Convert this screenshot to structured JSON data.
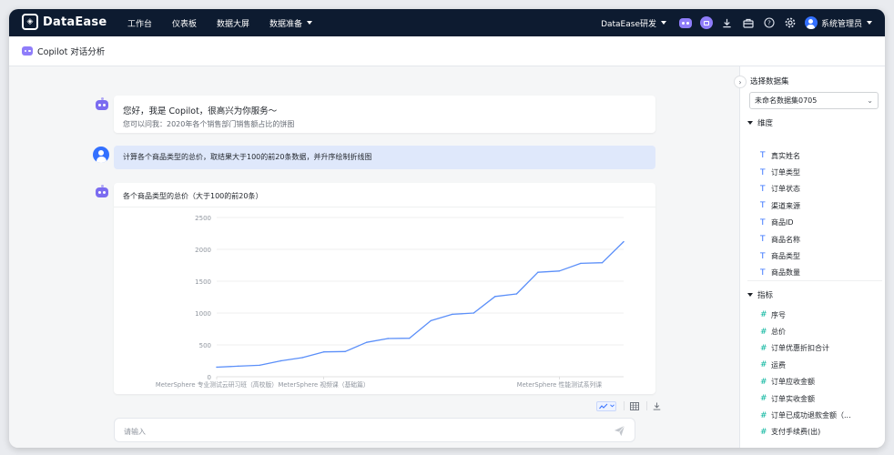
{
  "app": {
    "logo_text": "DataEase",
    "nav": [
      {
        "label": "工作台",
        "has_caret": false
      },
      {
        "label": "仪表板",
        "has_caret": false
      },
      {
        "label": "数据大屏",
        "has_caret": false
      },
      {
        "label": "数据准备",
        "has_caret": true
      }
    ],
    "workspace": "DataEase研发",
    "user": "系统管理员",
    "icons": [
      "copilot-icon",
      "ai-chat-icon",
      "download-icon",
      "toolbox-icon",
      "help-icon",
      "settings-icon"
    ]
  },
  "page": {
    "title": "Copilot 对话分析"
  },
  "chat": {
    "greeting": {
      "title": "您好，我是 Copilot，很高兴为你服务～",
      "subtitle": "您可以问我：2020年各个销售部门销售额占比的饼图"
    },
    "user_message": "计算各个商品类型的总价，取结果大于100的前20条数据，并升序绘制折线图",
    "answer": {
      "chart_title": "各个商品类型的总价（大于100的前20条）"
    },
    "input_placeholder": "请输入"
  },
  "chart_data": {
    "type": "line",
    "title": "各个商品类型的总价（大于100的前20条）",
    "ylim": [
      0,
      2500
    ],
    "yticks": [
      "0",
      "500",
      "1000",
      "1500",
      "2000",
      "2500"
    ],
    "x_tick_labels": [
      {
        "index": 0,
        "label": "MeterSphere 专业测试云研习班（高校版）"
      },
      {
        "index": 5,
        "label": "MeterSphere 视频课（基础篇）"
      },
      {
        "index": 16,
        "label": "MeterSphere 性能测试系列课"
      }
    ],
    "values": [
      150,
      165,
      180,
      250,
      300,
      390,
      395,
      540,
      600,
      605,
      880,
      980,
      1000,
      1260,
      1300,
      1640,
      1660,
      1780,
      1790,
      2120
    ],
    "color": "#5b8ff9",
    "grid": true
  },
  "chart_tools": {
    "active_type": "line-chart-icon"
  },
  "panel": {
    "title": "选择数据集",
    "dataset": "未命名数据集0705",
    "dimension_header": "维度",
    "dimensions": [
      "真实姓名",
      "订单类型",
      "订单状态",
      "渠道来源",
      "商品ID",
      "商品名称",
      "商品类型",
      "商品数量"
    ],
    "dimension_type_glyph": "T",
    "measure_header": "指标",
    "measures": [
      "序号",
      "总价",
      "订单优惠折扣合计",
      "运费",
      "订单应收金额",
      "订单实收金额",
      "订单已成功退款金额（...",
      "支付手续费(出)"
    ],
    "measure_type_glyph": "#"
  }
}
